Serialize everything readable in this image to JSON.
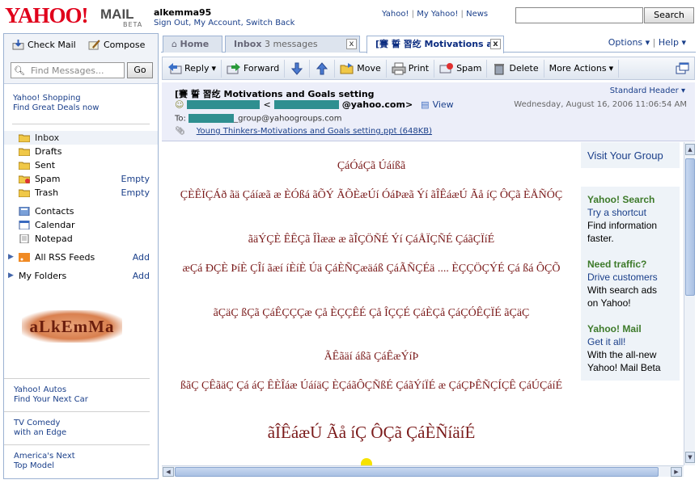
{
  "header": {
    "logo_text": "YAHOO!",
    "logo_mail": "MAIL",
    "logo_beta": "BETA",
    "username": "alkemma95",
    "user_links": [
      "Sign Out",
      "My Account",
      "Switch Back"
    ],
    "top_links": [
      "Yahoo!",
      "My Yahoo!",
      "News"
    ],
    "search_button": "Search",
    "search_value": ""
  },
  "sidebar": {
    "check_mail": "Check Mail",
    "compose": "Compose",
    "find_placeholder": "Find Messages...",
    "go": "Go",
    "promo": [
      "Yahoo! Shopping",
      "Find Great Deals now"
    ],
    "folders": [
      {
        "name": "Inbox",
        "action": ""
      },
      {
        "name": "Drafts",
        "action": ""
      },
      {
        "name": "Sent",
        "action": ""
      },
      {
        "name": "Spam",
        "action": "Empty"
      },
      {
        "name": "Trash",
        "action": "Empty"
      }
    ],
    "apps": [
      "Contacts",
      "Calendar",
      "Notepad"
    ],
    "rss": {
      "name": "All RSS Feeds",
      "action": "Add"
    },
    "myfolders": {
      "name": "My Folders",
      "action": "Add"
    },
    "avatar_text": "aLkEmMa",
    "bottom_promos": [
      [
        "Yahoo! Autos",
        "Find Your Next Car"
      ],
      [
        "TV Comedy",
        "with an Edge"
      ],
      [
        "America's Next",
        "Top Model"
      ]
    ]
  },
  "tabs": {
    "home": "Home",
    "inbox": "Inbox",
    "inbox_count": "3 messages",
    "message_tab": "[賽 誓 習纥 Motivations a",
    "close": "x",
    "options": "Options",
    "help": "Help"
  },
  "toolbar": [
    "Reply",
    "Forward",
    "Move",
    "Print",
    "Spam",
    "Delete",
    "More Actions"
  ],
  "message": {
    "subject": "[賽 誓 習纥 Motivations and Goals setting",
    "standard_header": "Standard Header",
    "from_domain": "@yahoo.com>",
    "from_lt": "<",
    "view": "View",
    "date": "Wednesday, August 16, 2006 11:06:54 AM",
    "to_label": "To:",
    "to_suffix": "_group@yahoogroups.com",
    "attachment": "Young Thinkers-Motivations and Goals setting.ppt (648KB)"
  },
  "body_lines": [
    "ÇáÓáÇã Úáíßã",
    "ÇÈÊÏÇÁð ãä Çáíæã æ ÈÓßá ãÕÝ ÃÕÈæÚí ÓáÞæã Ýí ãÎÊáæÚ Ãå íÇ ÔÇã ÈÅÑÓÇ",
    "ãäÝÇÈ ÊÊÇã ÎÌææ æ ãÎÇÖÑÉ Ýí ÇáÅÏÇÑÉ ÇáãÇÏíÉ",
    "æÇá ÐÇÈ ÞíÈ ÇÎí ãæí íÈíÈ Úä ÇáÈÑÇæäáß ÇáÃÑÇÉä .... ÈÇÇÖÇÝÉ Çá ßá ÔÇÕ",
    "ãÇäÇ ßÇã ÇáÊÇÇÇæ Çå ÈÇÇÊÉ Çå ÎÇÇÉ ÇáÈÇå ÇáÇÓÊÇÏÉ ãÇäÇ",
    "ÃÊãäí áßã ÇáÊæÝíÞ",
    "ßãÇ ÇÊãäÇ Çá áÇ ÊÈÎáæ ÚáíäÇ ÈÇáãÔÇÑßÉ ÇáãÝíÏÉ æ ÇáÇÞÊÑÇÍÇÊ ÇáÚÇáíÉ",
    "ãÎÊáæÚ Ãå íÇ ÔÇã ÇáÈÑíäíÉ"
  ],
  "ads": {
    "visit": "Visit Your Group",
    "items": [
      {
        "head": "Yahoo! Search",
        "link": "Try a shortcut",
        "text": [
          "Find information",
          "faster."
        ]
      },
      {
        "head": "Need traffic?",
        "link": "Drive customers",
        "text": [
          "With search ads",
          "on Yahoo!"
        ]
      },
      {
        "head": "Yahoo! Mail",
        "link": "Get it all!",
        "text": [
          "With the all-new",
          "Yahoo! Mail Beta"
        ]
      }
    ]
  },
  "colors": {
    "yahoo_red": "#e0001b",
    "link_blue": "#1a3f8a",
    "body_text": "#7a1a1a",
    "ad_green": "#3d7a2a",
    "redact_teal": "#2f8f90"
  }
}
